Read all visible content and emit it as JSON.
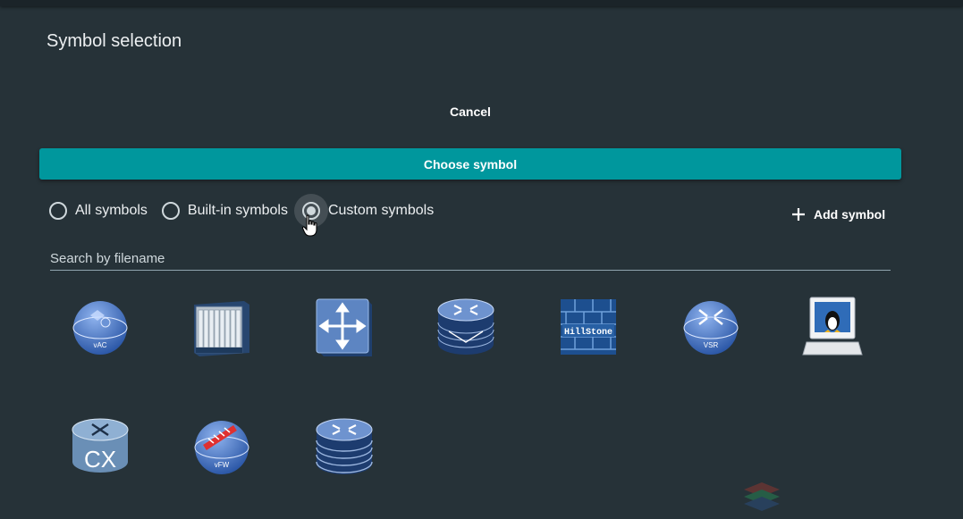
{
  "dialog": {
    "title": "Symbol selection",
    "cancel_label": "Cancel",
    "choose_label": "Choose symbol"
  },
  "filter": {
    "options": [
      {
        "label": "All symbols",
        "selected": false
      },
      {
        "label": "Built-in symbols",
        "selected": false
      },
      {
        "label": "Custom symbols",
        "selected": true
      }
    ]
  },
  "add_symbol_label": "Add symbol",
  "search": {
    "placeholder": "Search by filename",
    "value": ""
  },
  "symbols": [
    {
      "icon": "vac-icon",
      "text": "vAC"
    },
    {
      "icon": "chassis-switch-icon",
      "text": ""
    },
    {
      "icon": "layer3-switch-icon",
      "text": ""
    },
    {
      "icon": "router-icon",
      "text": ""
    },
    {
      "icon": "hillstone-firewall-icon",
      "text": "HillStone"
    },
    {
      "icon": "vsr-router-icon",
      "text": "VSR"
    },
    {
      "icon": "linux-host-icon",
      "text": ""
    },
    {
      "icon": "cx-switch-icon",
      "text": "CX"
    },
    {
      "icon": "vfw-firewall-icon",
      "text": "vFW"
    },
    {
      "icon": "stacked-router-icon",
      "text": ""
    }
  ],
  "colors": {
    "background": "#263238",
    "accent": "#00979d",
    "text": "#eceff1"
  }
}
